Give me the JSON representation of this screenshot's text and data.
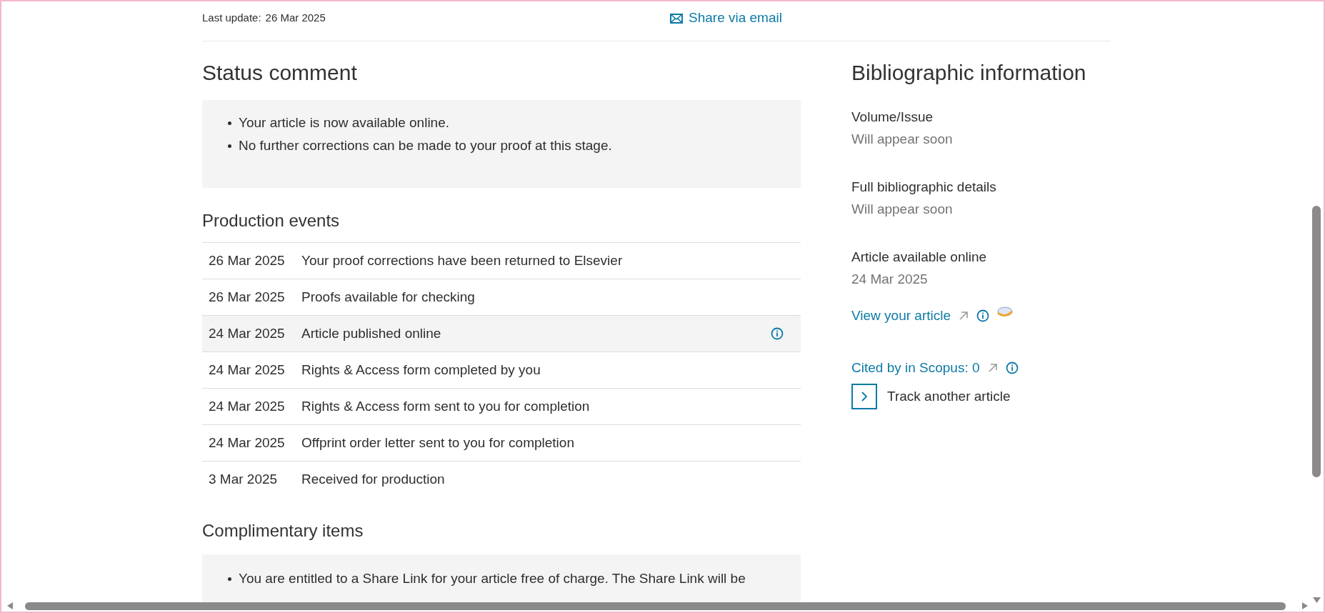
{
  "header": {
    "last_update_label": "Last update:",
    "last_update_date": "26 Mar 2025",
    "share_link": "Share via email"
  },
  "status_comment": {
    "title": "Status comment",
    "items": [
      "Your article is now available online.",
      "No further corrections can be made to your proof at this stage."
    ]
  },
  "production_events": {
    "title": "Production events",
    "rows": [
      {
        "date": "26 Mar 2025",
        "event": "Your proof corrections have been returned to Elsevier",
        "highlighted": false,
        "info": false
      },
      {
        "date": "26 Mar 2025",
        "event": "Proofs available for checking",
        "highlighted": false,
        "info": false
      },
      {
        "date": "24 Mar 2025",
        "event": "Article published online",
        "highlighted": true,
        "info": true
      },
      {
        "date": "24 Mar 2025",
        "event": "Rights & Access form completed by you",
        "highlighted": false,
        "info": false
      },
      {
        "date": "24 Mar 2025",
        "event": "Rights & Access form sent to you for completion",
        "highlighted": false,
        "info": false
      },
      {
        "date": "24 Mar 2025",
        "event": "Offprint order letter sent to you for completion",
        "highlighted": false,
        "info": false
      },
      {
        "date": "3 Mar 2025",
        "event": "Received for production",
        "highlighted": false,
        "info": false
      }
    ]
  },
  "complimentary_items": {
    "title": "Complimentary items",
    "items": [
      "You are entitled to a Share Link for your article free of charge. The Share Link will be"
    ]
  },
  "bibliographic_information": {
    "title": "Bibliographic information",
    "fields": [
      {
        "label": "Volume/Issue",
        "value": "Will appear soon"
      },
      {
        "label": "Full bibliographic details",
        "value": "Will appear soon"
      },
      {
        "label": "Article available online",
        "value": "24 Mar 2025"
      }
    ],
    "view_article_link": "View your article",
    "cited_link": "Cited by in Scopus: 0",
    "track_button": "Track another article"
  }
}
